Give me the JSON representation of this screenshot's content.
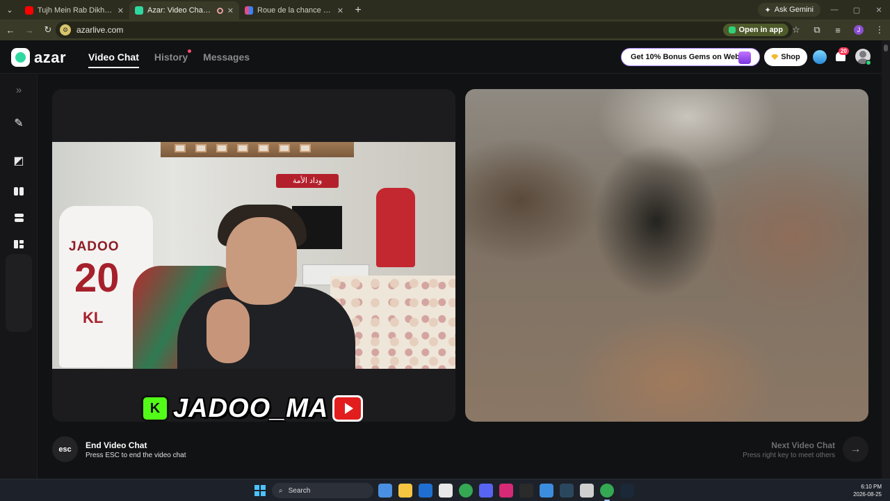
{
  "browser": {
    "tabs": [
      {
        "title": "Tujh Mein Rab Dikhta Hai Song",
        "favicon_color": "#ff0000",
        "active": false
      },
      {
        "title": "Azar: Video Chat with New",
        "favicon_color": "#2fd8a0",
        "active": true
      },
      {
        "title": "Roue de la chance – roue aléat",
        "favicon_color": "#e34c8b",
        "active": false
      }
    ],
    "new_tab_label": "+",
    "ask_gemini_label": "Ask Gemini",
    "url": "azarlive.com",
    "open_in_app_label": "Open in app",
    "profile_initial": "J"
  },
  "app": {
    "logo_text": "azar",
    "nav": {
      "video_chat": "Video Chat",
      "history": "History",
      "messages": "Messages"
    },
    "promo_label": "Get 10% Bonus Gems on Web!",
    "shop_label": "Shop",
    "notification_count": "20"
  },
  "sidebar": {
    "expand_icon": "chevron-double-right-icon",
    "items": [
      "magic-wand-icon",
      "filter-icon",
      "layout-side-by-side-icon",
      "layout-stacked-icon",
      "layout-mixed-icon"
    ]
  },
  "video": {
    "local": {
      "jersey_name": "JADOO",
      "jersey_number": "20",
      "jersey_initials": "KL",
      "banner_text": "وداد الأمة",
      "overlay_handle": "JADOO_MA",
      "kick_letter": "K"
    },
    "remote": {
      "state": "blurred"
    }
  },
  "controls": {
    "esc_label": "esc",
    "end_title": "End Video Chat",
    "end_subtitle": "Press ESC to end the video chat",
    "next_title": "Next Video Chat",
    "next_subtitle": "Press right key to meet others",
    "next_icon": "arrow-right-icon"
  },
  "taskbar": {
    "search_placeholder": "Search",
    "time": "6:10 PM",
    "date": "2026-08-25",
    "apps": [
      {
        "name": "widgets-icon",
        "color": "#4a90e2"
      },
      {
        "name": "file-explorer-icon",
        "color": "#f5c542"
      },
      {
        "name": "outlook-icon",
        "color": "#1f6fd1"
      },
      {
        "name": "store-icon",
        "color": "#e8e8e8"
      },
      {
        "name": "chrome-icon",
        "color": "#34a853"
      },
      {
        "name": "discord-icon",
        "color": "#5865f2"
      },
      {
        "name": "instagram-icon",
        "color": "#d62976"
      },
      {
        "name": "obs-icon",
        "color": "#2b2b2b"
      },
      {
        "name": "app-icon",
        "color": "#3c8dde"
      },
      {
        "name": "steam-icon",
        "color": "#2a475e"
      },
      {
        "name": "capture-icon",
        "color": "#cfcfcf"
      },
      {
        "name": "chrome-active-icon",
        "color": "#34a853"
      },
      {
        "name": "steam-2-icon",
        "color": "#1b2838"
      }
    ]
  }
}
